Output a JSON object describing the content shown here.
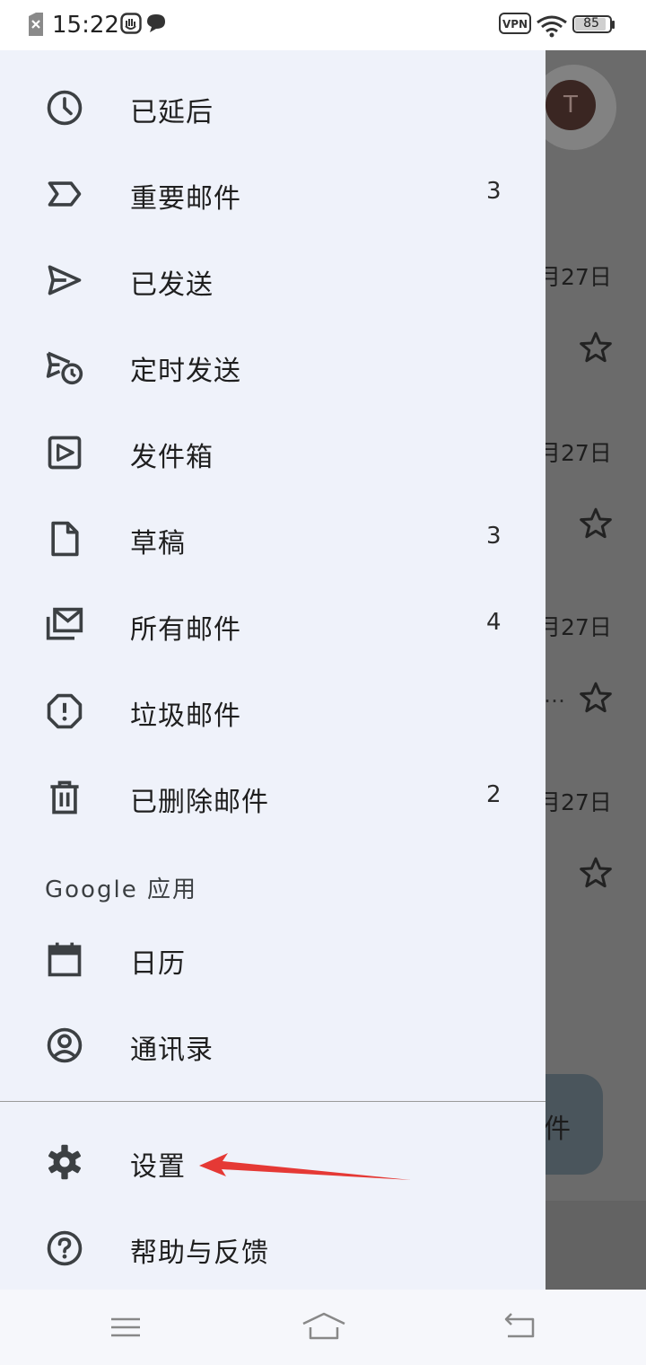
{
  "status_bar": {
    "time": "15:22",
    "left_icons": [
      "sim-off-icon",
      "hand-icon",
      "chat-icon"
    ],
    "vpn": "VPN",
    "battery": "85"
  },
  "drawer": {
    "items": [
      {
        "label": "已延后",
        "icon": "clock-icon",
        "count": ""
      },
      {
        "label": "重要邮件",
        "icon": "important-icon",
        "count": "3"
      },
      {
        "label": "已发送",
        "icon": "send-icon",
        "count": ""
      },
      {
        "label": "定时发送",
        "icon": "scheduled-send-icon",
        "count": ""
      },
      {
        "label": "发件箱",
        "icon": "outbox-icon",
        "count": ""
      },
      {
        "label": "草稿",
        "icon": "draft-icon",
        "count": "3"
      },
      {
        "label": "所有邮件",
        "icon": "all-mail-icon",
        "count": "4"
      },
      {
        "label": "垃圾邮件",
        "icon": "spam-icon",
        "count": ""
      },
      {
        "label": "已删除邮件",
        "icon": "trash-icon",
        "count": "2"
      }
    ],
    "section_header": "Google 应用",
    "app_items": [
      {
        "label": "日历",
        "icon": "calendar-icon"
      },
      {
        "label": "通讯录",
        "icon": "contacts-icon"
      }
    ],
    "bottom_items": [
      {
        "label": "设置",
        "icon": "gear-icon"
      },
      {
        "label": "帮助与反馈",
        "icon": "help-icon"
      }
    ]
  },
  "background": {
    "avatar_letter": "T",
    "dates": [
      "月27日",
      "月27日",
      "月27日",
      "月27日"
    ],
    "ellipsis": "…",
    "fab_text": "件"
  },
  "colors": {
    "drawer_bg": "#eff2fa",
    "scrim": "#6b6b6b",
    "annotation_arrow": "#e53935"
  }
}
